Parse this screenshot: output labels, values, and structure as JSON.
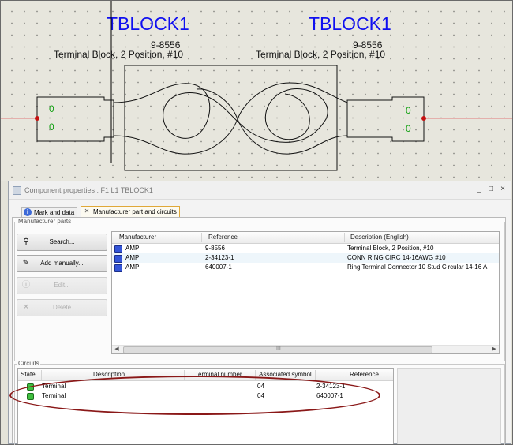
{
  "canvas": {
    "left_block": {
      "name": "TBLOCK1",
      "ref": "9-8556",
      "description": "Terminal Block, 2 Position, #10",
      "pins": [
        "0",
        "0"
      ]
    },
    "right_block": {
      "name": "TBLOCK1",
      "ref": "9-8556",
      "description": "Terminal Block, 2 Position, #10",
      "pins": [
        "0",
        "0"
      ]
    }
  },
  "dialog": {
    "title": "Component properties : F1 L1 TBLOCK1",
    "window_buttons": {
      "min": "_",
      "max": "□",
      "close": "×"
    },
    "tabs": [
      {
        "label": "Mark and data",
        "icon": "info-icon"
      },
      {
        "label": "Manufacturer part and circuits",
        "icon": "tools-icon"
      }
    ],
    "manufacturer_parts": {
      "group_label": "Manufacturer parts",
      "buttons": {
        "search": "Search...",
        "add_manually": "Add manually...",
        "edit": "Edit...",
        "delete": "Delete"
      },
      "columns": [
        "Manufacturer",
        "Reference",
        "Description (English)"
      ],
      "rows": [
        {
          "manufacturer": "AMP",
          "reference": "9-8556",
          "description": "Terminal Block, 2 Position, #10"
        },
        {
          "manufacturer": "AMP",
          "reference": "2-34123-1",
          "description": "CONN RING CIRC 14-16AWG #10"
        },
        {
          "manufacturer": "AMP",
          "reference": "640007-1",
          "description": "Ring Terminal Connector 10 Stud Circular 14-16 A"
        }
      ],
      "scroll_grip": "III"
    },
    "circuits": {
      "group_label": "Circuits",
      "columns": [
        "State",
        "Description",
        "Terminal number",
        "Associated symbol",
        "Reference"
      ],
      "rows": [
        {
          "description": "Terminal",
          "terminal_number": "04",
          "reference": "2-34123-1"
        },
        {
          "description": "Terminal",
          "terminal_number": "04",
          "reference": "640007-1"
        }
      ]
    }
  },
  "colors": {
    "title_blue": "#1010f0",
    "pin_green": "#10a010",
    "annotation_red": "#8a1818"
  }
}
